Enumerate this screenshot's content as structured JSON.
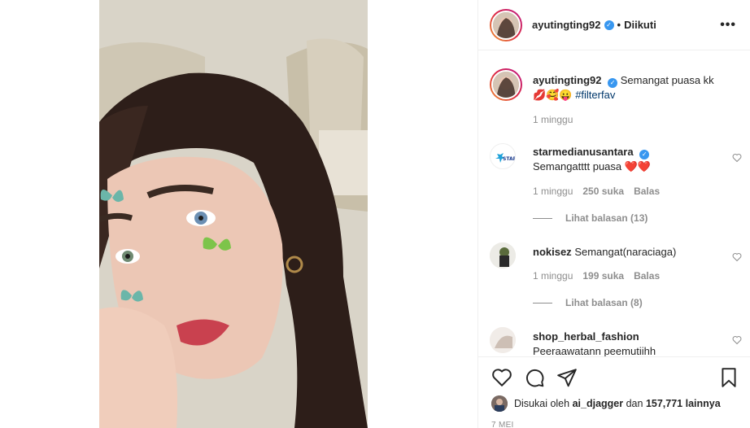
{
  "post": {
    "author": "ayutingting92",
    "follow_label": "Diikuti",
    "dot": "•",
    "more": "•••"
  },
  "caption": {
    "username": "ayutingting92",
    "text": "Semangat puasa kk",
    "emojis": "💋🥰😛",
    "hashtag": "#filterfav",
    "time": "1 minggu"
  },
  "comments": [
    {
      "username": "starmedianusantara",
      "text": "Semangatttt puasa ❤️❤️",
      "time": "1 minggu",
      "likes": "250 suka",
      "reply": "Balas",
      "view_replies": "Lihat balasan (13)"
    },
    {
      "username": "nokisez",
      "text": "Semangat(naraciaga)",
      "time": "1 minggu",
      "likes": "199 suka",
      "reply": "Balas",
      "view_replies": "Lihat balasan (8)"
    },
    {
      "username": "shop_herbal_fashion",
      "text": "Peeraawatann peemutiihh"
    }
  ],
  "likes_summary": {
    "prefix": "Disukai oleh",
    "user": "ai_djagger",
    "middle": "dan",
    "count": "157,771",
    "suffix": "lainnya"
  },
  "date": "7 MEI",
  "colors": {
    "verified": "#3897f0",
    "hashtag": "#00376b",
    "secondary_text": "#8e8e8e",
    "heart_red": "#ed4956"
  },
  "icons": [
    "heart-icon",
    "comment-icon",
    "share-icon",
    "bookmark-icon",
    "verified-icon",
    "more-icon"
  ]
}
